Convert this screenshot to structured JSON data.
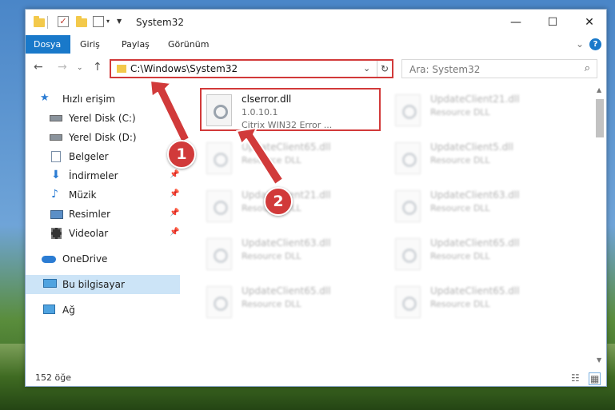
{
  "window": {
    "title": "System32",
    "controls": {
      "minimize": "—",
      "maximize": "☐",
      "close": "✕"
    }
  },
  "ribbon": {
    "tabs": [
      "Dosya",
      "Giriş",
      "Paylaş",
      "Görünüm"
    ],
    "active_tab": "Dosya",
    "help": "?"
  },
  "address_bar": {
    "path": "C:\\Windows\\System32"
  },
  "search": {
    "placeholder": "Ara: System32"
  },
  "sidebar": {
    "items": [
      {
        "label": "Hızlı erişim",
        "icon": "star-icon"
      },
      {
        "label": "Yerel Disk (C:)",
        "icon": "drive-icon",
        "pinned": true
      },
      {
        "label": "Yerel Disk (D:)",
        "icon": "drive-icon"
      },
      {
        "label": "Belgeler",
        "icon": "documents-icon"
      },
      {
        "label": "İndirmeler",
        "icon": "download-icon",
        "pinned": true
      },
      {
        "label": "Müzik",
        "icon": "music-icon",
        "pinned": true
      },
      {
        "label": "Resimler",
        "icon": "pictures-icon",
        "pinned": true
      },
      {
        "label": "Videolar",
        "icon": "video-icon",
        "pinned": true
      },
      {
        "label": "OneDrive",
        "icon": "cloud-icon"
      },
      {
        "label": "Bu bilgisayar",
        "icon": "computer-icon",
        "selected": true
      },
      {
        "label": "Ağ",
        "icon": "network-icon"
      }
    ]
  },
  "files": [
    {
      "name": "clserror.dll",
      "version": "1.0.10.1",
      "description": "Citrix WIN32 Error ...",
      "highlighted": true
    },
    {
      "name": "UpdateClient21.dll",
      "version": "Resource DLL",
      "blurred": true
    },
    {
      "name": "UpdateClient65.dll",
      "version": "Resource DLL",
      "blurred": true
    },
    {
      "name": "UpdateClient5.dll",
      "version": "Resource DLL",
      "blurred": true
    },
    {
      "name": "UpdateClient21.dll",
      "version": "Resource DLL",
      "blurred": true
    },
    {
      "name": "UpdateClient63.dll",
      "version": "Resource DLL",
      "blurred": true
    },
    {
      "name": "UpdateClient63.dll",
      "version": "Resource DLL",
      "blurred": true
    },
    {
      "name": "UpdateClient65.dll",
      "version": "Resource DLL",
      "blurred": true
    },
    {
      "name": "UpdateClient65.dll",
      "version": "Resource DLL",
      "blurred": true
    },
    {
      "name": "UpdateClient65.dll",
      "version": "Resource DLL",
      "blurred": true
    }
  ],
  "status": {
    "item_count": "152 öğe"
  },
  "annotations": {
    "badge1": "1",
    "badge2": "2",
    "color": "#d13a3a"
  }
}
